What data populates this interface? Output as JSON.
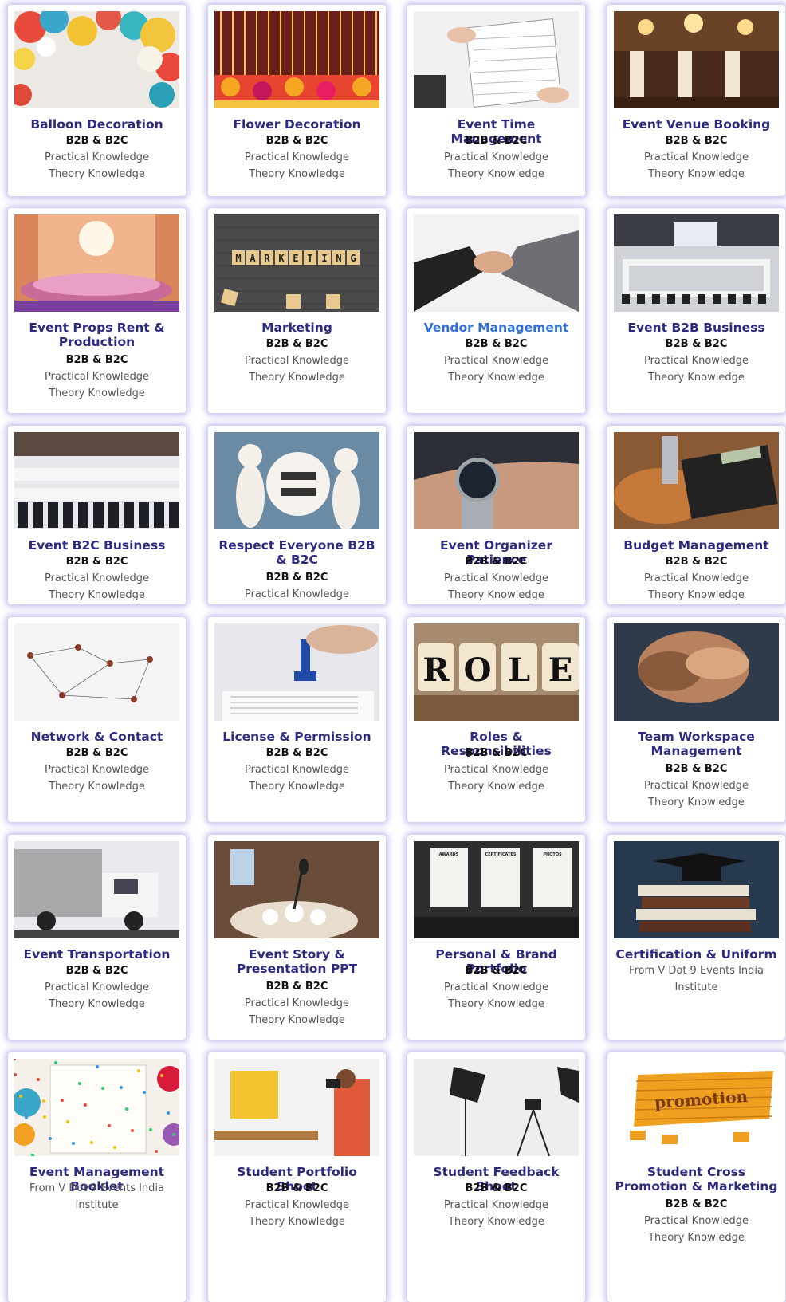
{
  "cards": [
    {
      "title": "Balloon Decoration",
      "subtitle": "B2B & B2C",
      "line1": "Practical Knowledge",
      "line2": "Theory Knowledge",
      "image": "balloons"
    },
    {
      "title": "Flower Decoration",
      "subtitle": "B2B & B2C",
      "line1": "Practical Knowledge",
      "line2": "Theory Knowledge",
      "image": "flowers"
    },
    {
      "title": "Event Time Management",
      "subtitle": "B2B & B2C",
      "line1": "Practical Knowledge",
      "line2": "Theory Knowledge",
      "image": "calendar"
    },
    {
      "title": "Event Venue Booking",
      "subtitle": "B2B & B2C",
      "line1": "Practical Knowledge",
      "line2": "Theory Knowledge",
      "image": "venue-hall"
    },
    {
      "title": "Event Props Rent & Production",
      "subtitle": "B2B & B2C",
      "line1": "Practical Knowledge",
      "line2": "Theory Knowledge",
      "image": "stage"
    },
    {
      "title": "Marketing",
      "subtitle": "B2B & B2C",
      "line1": "Practical Knowledge",
      "line2": "Theory Knowledge",
      "image": "marketing-tiles"
    },
    {
      "title": "Vendor Management",
      "subtitle": "B2B & B2C",
      "line1": "Practical Knowledge",
      "line2": "Theory Knowledge",
      "image": "handshake"
    },
    {
      "title": "Event B2B Business",
      "subtitle": "B2B & B2C",
      "line1": "Practical Knowledge",
      "line2": "Theory Knowledge",
      "image": "conference"
    },
    {
      "title": "Event B2C Business",
      "subtitle": "B2B & B2C",
      "line1": "Practical Knowledge",
      "line2": "Theory Knowledge",
      "image": "chairs"
    },
    {
      "title": "Respect Everyone B2B & B2C",
      "subtitle": "B2B & B2C",
      "line1": "Practical Knowledge",
      "line2": "",
      "image": "equal"
    },
    {
      "title": "Event Organizer Patience",
      "subtitle": "B2B & B2C",
      "line1": "Practical Knowledge",
      "line2": "Theory Knowledge",
      "image": "watch"
    },
    {
      "title": "Budget Management",
      "subtitle": "B2B & B2C",
      "line1": "Practical Knowledge",
      "line2": "Theory Knowledge",
      "image": "calculator"
    },
    {
      "title": "Network & Contact",
      "subtitle": "B2B & B2C",
      "line1": "Practical Knowledge",
      "line2": "Theory Knowledge",
      "image": "network"
    },
    {
      "title": "License & Permission",
      "subtitle": "B2B & B2C",
      "line1": "Practical Knowledge",
      "line2": "Theory Knowledge",
      "image": "stamp"
    },
    {
      "title": "Roles & Responsibilities",
      "subtitle": "B2B & B2C",
      "line1": "Practical Knowledge",
      "line2": "Theory Knowledge",
      "image": "role-blocks"
    },
    {
      "title": "Team Workspace Management",
      "subtitle": "B2B & B2C",
      "line1": "Practical Knowledge",
      "line2": "Theory Knowledge",
      "image": "team-hands"
    },
    {
      "title": "Event Transportation",
      "subtitle": "B2B & B2C",
      "line1": "Practical Knowledge",
      "line2": "Theory Knowledge",
      "image": "truck"
    },
    {
      "title": "Event Story & Presentation PPT",
      "subtitle": "B2B & B2C",
      "line1": "Practical Knowledge",
      "line2": "Theory Knowledge",
      "image": "microphone"
    },
    {
      "title": "Personal & Brand Portfolio",
      "subtitle": "B2B & B2C",
      "line1": "Practical Knowledge",
      "line2": "Theory Knowledge",
      "image": "frames"
    },
    {
      "title": "Certification & Uniform",
      "subtitle": "",
      "line1": "From V Dot 9 Events India",
      "line2": "Institute",
      "image": "books-cap"
    },
    {
      "title": "Event Management Booklet",
      "subtitle": "",
      "line1": "From V Dot 9 Events India",
      "line2": "Institute",
      "image": "notebook"
    },
    {
      "title": "Student Portfolio Shoot",
      "subtitle": "B2B & B2C",
      "line1": "Practical Knowledge",
      "line2": "Theory Knowledge",
      "image": "photo-shoot"
    },
    {
      "title": "Student Feedback Shoot",
      "subtitle": "B2B & B2C",
      "line1": "Practical Knowledge",
      "line2": "Theory Knowledge",
      "image": "studio-lights"
    },
    {
      "title": "Student Cross Promotion & Marketing",
      "subtitle": "B2B & B2C",
      "line1": "Practical Knowledge",
      "line2": "Theory Knowledge",
      "image": "promotion-bricks"
    }
  ],
  "image_texts": {
    "marketing": "MARKETING",
    "role": [
      "R",
      "O",
      "L",
      "E"
    ],
    "frame_labels": [
      "AWARDS",
      "CERTIFICATES",
      "PHOTOS"
    ],
    "promotion": "promotion"
  },
  "colors": {
    "title": "#2e2a80",
    "link": "#2f6fd6",
    "shadow": "#7a6edc"
  }
}
